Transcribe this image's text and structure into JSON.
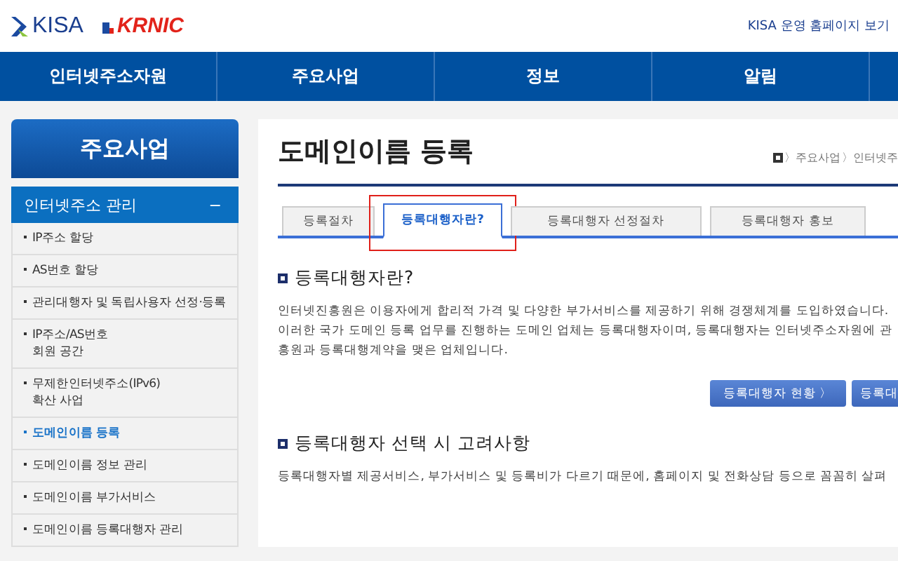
{
  "header": {
    "logos": [
      "KISA",
      "KRNIC"
    ],
    "top_link": "KISA 운영 홈페이지 보기"
  },
  "nav": [
    "인터넷주소자원",
    "주요사업",
    "정보",
    "알림"
  ],
  "sidebar": {
    "title": "주요사업",
    "section": {
      "label": "인터넷주소 관리",
      "toggle": "−",
      "expanded": true
    },
    "items": [
      {
        "label": "IP주소 할당",
        "selected": false
      },
      {
        "label": "AS번호 할당",
        "selected": false
      },
      {
        "label": "관리대행자 및 독립사용자 선정·등록",
        "selected": false
      },
      {
        "label": "IP주소/AS번호\n회원 공간",
        "selected": false
      },
      {
        "label": "무제한인터넷주소(IPv6)\n확산 사업",
        "selected": false
      },
      {
        "label": "도메인이름 등록",
        "selected": true
      },
      {
        "label": "도메인이름 정보 관리",
        "selected": false
      },
      {
        "label": "도메인이름 부가서비스",
        "selected": false
      },
      {
        "label": "도메인이름 등록대행자 관리",
        "selected": false
      }
    ]
  },
  "main": {
    "title": "도메인이름 등록",
    "breadcrumb": [
      "〉주요사업",
      "〉인터넷주"
    ],
    "tabs": [
      {
        "label": "등록절차",
        "selected": false,
        "highlighted": false
      },
      {
        "label": "등록대행자란?",
        "selected": true,
        "highlighted": true
      },
      {
        "label": "등록대행자 선정절차",
        "selected": false,
        "highlighted": false
      },
      {
        "label": "등록대행자 홍보",
        "selected": false,
        "highlighted": false
      }
    ],
    "sections": [
      {
        "heading": "등록대행자란?",
        "paragraph": [
          "인터넷진흥원은 이용자에게 합리적 가격 및 다양한 부가서비스를 제공하기 위해 경쟁체계를 도입하였습니다.",
          "이러한 국가 도메인 등록 업무를 진행하는 도메인 업체는 등록대행자이며, 등록대행자는 인터넷주소자원에 관",
          "흥원과 등록대행계약을 맺은 업체입니다."
        ],
        "buttons": [
          "등록대행자 현황  〉",
          "등록대"
        ]
      },
      {
        "heading": "등록대행자 선택 시 고려사항",
        "paragraph": [
          "등록대행자별 제공서비스, 부가서비스 및 등록비가 다르기 때문에, 홈페이지 및 전화상담 등으로 꼼꼼히 살펴"
        ]
      }
    ]
  }
}
